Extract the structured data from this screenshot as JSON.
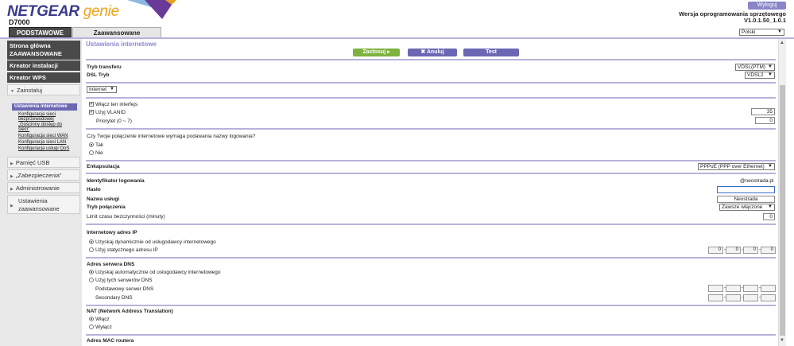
{
  "header": {
    "logo_brand": "NETGEAR",
    "logo_genie": "genie",
    "model": "D7000",
    "logout": "Wyloguj",
    "fw_label": "Wersja oprogramowania sprzętowego",
    "fw_value": "V1.0.1.50_1.0.1",
    "language": "Polski"
  },
  "tabs": {
    "basic": "PODSTAWOWE",
    "advanced": "Zaawansowane"
  },
  "sidebar": {
    "home_line1": "Strona główna",
    "home_line2": "ZAAWANSOWANE",
    "setup_wizard": "Kreator instalacji",
    "wps_wizard": "Kreator WPS",
    "setup": "Zainstaluj",
    "sub": {
      "internet": "Ustawienia internetowe",
      "wireless_1": "Konfiguracja sieci",
      "wireless_2": "bezprzewodowej",
      "guest_1": "„Gościnny dostęp do",
      "guest_2": "sieci”",
      "wan": "Konfiguracja sieci WAN",
      "lan": "Konfiguracja sieci LAN",
      "qos": "Konfiguracja usługi QoS"
    },
    "usb": "Pamięć USB",
    "security": "„Zabezpieczenia”",
    "admin": "Administrowanie",
    "advanced_1": "Ustawienia",
    "advanced_2": "zaawansowane"
  },
  "main": {
    "title": "Ustawienia internetowe",
    "buttons": {
      "apply": "Zastosuj ▸",
      "cancel": "✖ Anuluj",
      "test": "Test"
    },
    "transfer_mode_label": "Tryb transferu",
    "transfer_mode_value": "VDSL(PTM)",
    "dsl_mode_label": "DSL Tryb",
    "dsl_mode_value": "VDSL2",
    "interface_value": "Internet",
    "enable_interface": "Włącz ten interfejs",
    "use_vlan": "Użyj VLANID",
    "vlan_value": "35",
    "priority_label": "Priorytet (0 ~ 7)",
    "priority_value": "0",
    "login_question": "Czy Twoje połączenie internetowe wymaga podawania nazwy logowania?",
    "yes": "Tak",
    "no": "Nie",
    "encap_label": "Enkapsulacja",
    "encap_value": "PPPoE (PPP over Ethernet)",
    "login_label": "Identyfikator logowania",
    "login_value": "@neostrada.pl",
    "password_label": "Hasło",
    "service_label": "Nazwa usługi",
    "service_value": "Neostrada",
    "conn_mode_label": "Tryb połączenia",
    "conn_mode_value": "Zawsze włączone",
    "idle_label": "Limit czasu bezczynności (minuty)",
    "idle_value": "0",
    "ip_section": "Internetowy adres IP",
    "ip_dynamic": "Uzyskaj dynamicznie od usługodawcy internetowego",
    "ip_static": "Użyj statycznego adresu IP",
    "ip_octets": [
      "0",
      "0",
      "0",
      "0"
    ],
    "dns_section": "Adres serwera DNS",
    "dns_auto": "Uzyskaj automatycznie od usługodawcy internetowego",
    "dns_manual": "Użyj tych serwerów DNS",
    "dns_primary": "Podstawowy serwer DNS",
    "dns_secondary": "Secondary DNS",
    "nat_section": "NAT (Network Address Translation)",
    "nat_on": "Włącz",
    "nat_off": "Wyłącz",
    "mac_section": "Adres MAC routera"
  }
}
